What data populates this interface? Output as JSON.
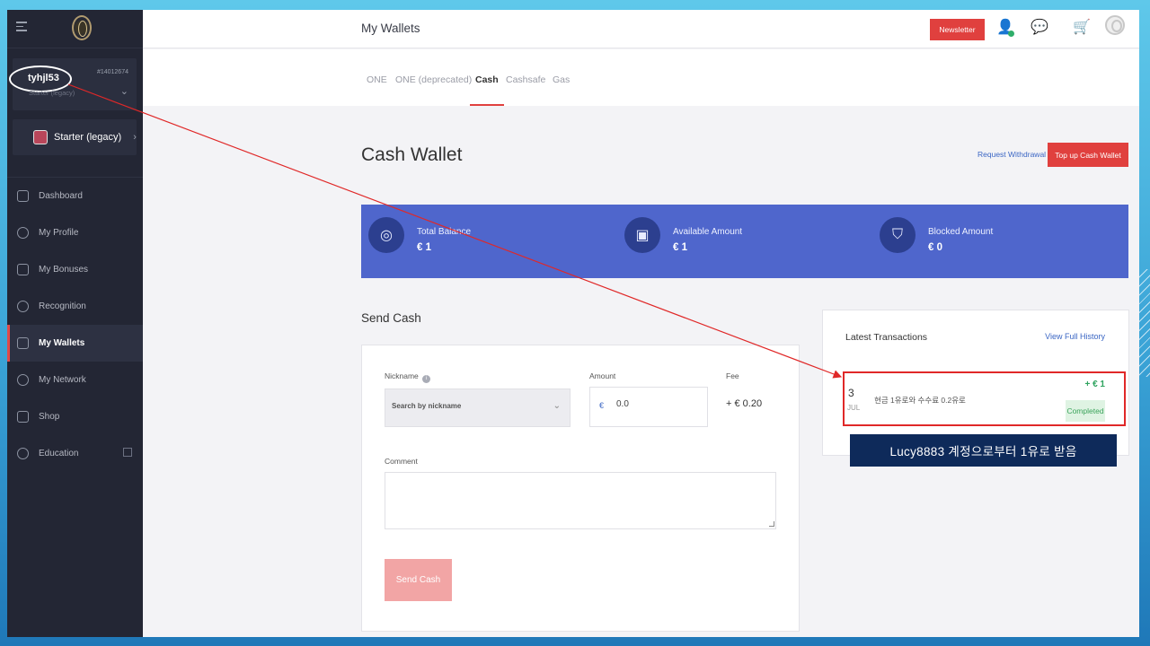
{
  "sidebar": {
    "user": {
      "name": "tyhjl53",
      "id": "#14012674",
      "plan_sub": "Starter (legacy)"
    },
    "plan_button": "Starter (legacy)",
    "items": [
      {
        "label": "Dashboard",
        "icon": "home-icon"
      },
      {
        "label": "My Profile",
        "icon": "user-icon"
      },
      {
        "label": "My Bonuses",
        "icon": "gift-icon"
      },
      {
        "label": "Recognition",
        "icon": "star-badge-icon"
      },
      {
        "label": "My Wallets",
        "icon": "wallet-icon",
        "active": true
      },
      {
        "label": "My Network",
        "icon": "network-icon"
      },
      {
        "label": "Shop",
        "icon": "cart-icon"
      },
      {
        "label": "Education",
        "icon": "education-icon"
      }
    ]
  },
  "header": {
    "title": "My Wallets",
    "newsletter": "Newsletter"
  },
  "tabs": [
    {
      "label": "ONE"
    },
    {
      "label": "ONE (deprecated)"
    },
    {
      "label": "Cash",
      "active": true
    },
    {
      "label": "Cashsafe"
    },
    {
      "label": "Gas"
    }
  ],
  "wallet": {
    "title": "Cash Wallet",
    "request_withdrawal": "Request Withdrawal",
    "top_up": "Top up Cash Wallet",
    "balances": [
      {
        "label": "Total Balance",
        "value": "€ 1",
        "icon": "coins-icon"
      },
      {
        "label": "Available Amount",
        "value": "€ 1",
        "icon": "safe-icon"
      },
      {
        "label": "Blocked Amount",
        "value": "€ 0",
        "icon": "shield-icon"
      }
    ]
  },
  "send": {
    "title": "Send Cash",
    "nickname_label": "Nickname",
    "nickname_placeholder": "Search by nickname",
    "amount_label": "Amount",
    "currency": "€",
    "amount_value": "0.0",
    "fee_label": "Fee",
    "fee_value": "+ € 0.20",
    "comment_label": "Comment",
    "button": "Send Cash"
  },
  "transactions": {
    "title": "Latest Transactions",
    "view_history": "View Full History",
    "items": [
      {
        "day": "3",
        "month": "JUL",
        "description": "현금 1유로와 수수료 0.2유로",
        "amount": "+ € 1",
        "status": "Completed"
      }
    ]
  },
  "caption": "Lucy8883 계정으로부터 1유로 받음",
  "colors": {
    "accent": "#e0403e",
    "balance_bar": "#4f66cc",
    "sidebar": "#232634",
    "annotation": "#e02828"
  }
}
